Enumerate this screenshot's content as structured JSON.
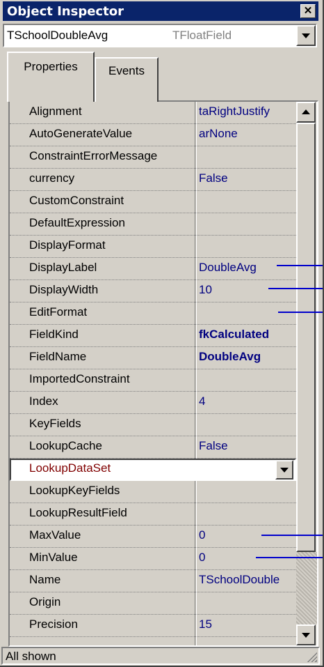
{
  "window": {
    "title": "Object Inspector"
  },
  "selector": {
    "object_name": "TSchoolDoubleAvg",
    "class_name": "TFloatField"
  },
  "tabs": [
    {
      "label": "Properties",
      "active": true
    },
    {
      "label": "Events",
      "active": false
    }
  ],
  "properties": [
    {
      "name": "Alignment",
      "value": "taRightJustify",
      "bold": false
    },
    {
      "name": "AutoGenerateValue",
      "value": "arNone",
      "bold": false
    },
    {
      "name": "ConstraintErrorMessage",
      "value": "",
      "bold": false
    },
    {
      "name": "currency",
      "value": "False",
      "bold": false
    },
    {
      "name": "CustomConstraint",
      "value": "",
      "bold": false
    },
    {
      "name": "DefaultExpression",
      "value": "",
      "bold": false
    },
    {
      "name": "DisplayFormat",
      "value": "",
      "bold": false
    },
    {
      "name": "DisplayLabel",
      "value": "DoubleAvg",
      "bold": false
    },
    {
      "name": "DisplayWidth",
      "value": "10",
      "bold": false
    },
    {
      "name": "EditFormat",
      "value": "",
      "bold": false
    },
    {
      "name": "FieldKind",
      "value": "fkCalculated",
      "bold": true
    },
    {
      "name": "FieldName",
      "value": "DoubleAvg",
      "bold": true
    },
    {
      "name": "ImportedConstraint",
      "value": "",
      "bold": false
    },
    {
      "name": "Index",
      "value": "4",
      "bold": false
    },
    {
      "name": "KeyFields",
      "value": "",
      "bold": false
    },
    {
      "name": "LookupCache",
      "value": "False",
      "bold": false
    },
    {
      "name": "LookupDataSet",
      "value": "",
      "bold": false,
      "selected": true
    },
    {
      "name": "LookupKeyFields",
      "value": "",
      "bold": false
    },
    {
      "name": "LookupResultField",
      "value": "",
      "bold": false
    },
    {
      "name": "MaxValue",
      "value": "0",
      "bold": false
    },
    {
      "name": "MinValue",
      "value": "0",
      "bold": false
    },
    {
      "name": "Name",
      "value": "TSchoolDouble",
      "bold": false
    },
    {
      "name": "Origin",
      "value": "",
      "bold": false
    },
    {
      "name": "Precision",
      "value": "15",
      "bold": false
    }
  ],
  "status": {
    "text": "All shown"
  },
  "colors": {
    "title_bar": "#0a246a",
    "value_text": "#000080",
    "selected_name": "#800000",
    "annotation_line": "#0000cc"
  }
}
